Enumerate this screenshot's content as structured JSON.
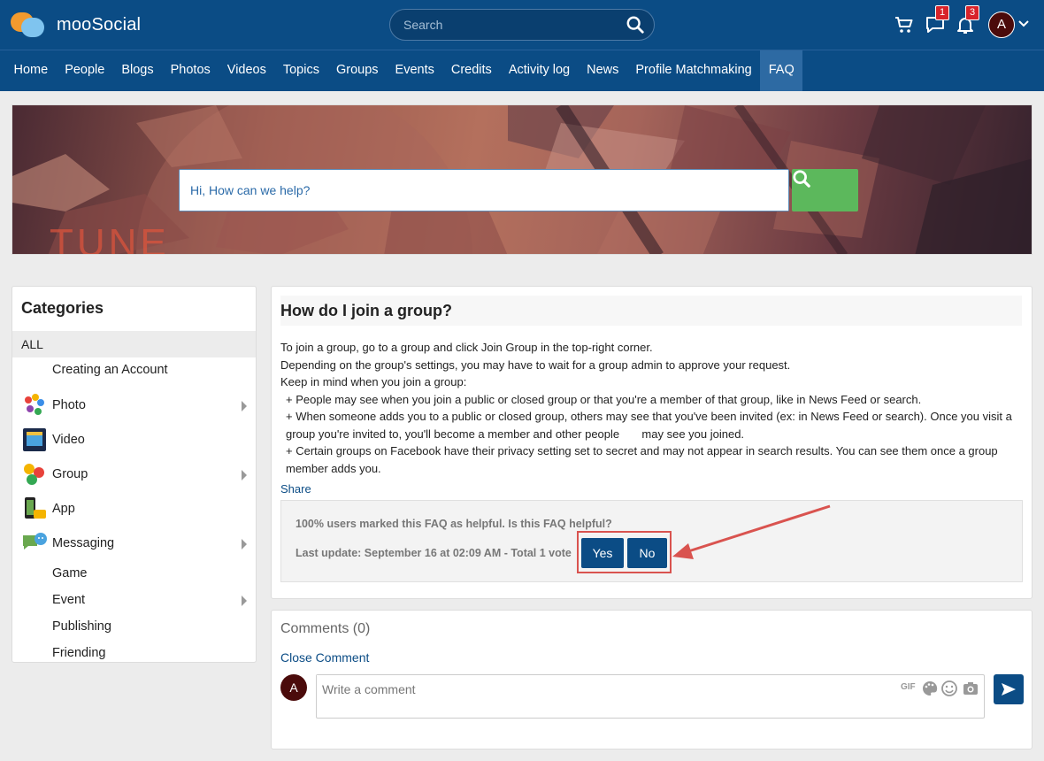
{
  "header": {
    "logo_text": "mooSocial",
    "search_placeholder": "Search",
    "messages_count": "1",
    "notifications_count": "3",
    "avatar_initial": "A"
  },
  "nav": {
    "items": [
      "Home",
      "People",
      "Blogs",
      "Photos",
      "Videos",
      "Topics",
      "Groups",
      "Events",
      "Credits",
      "Activity log",
      "News",
      "Profile Matchmaking",
      "FAQ"
    ],
    "active": "FAQ"
  },
  "banner": {
    "search_placeholder": "Hi, How can we help?"
  },
  "categories": {
    "title": "Categories",
    "all_label": "ALL",
    "items": [
      {
        "label": "Creating an Account",
        "icon": "none",
        "has_children": false
      },
      {
        "label": "Photo",
        "icon": "photo-icon",
        "has_children": true
      },
      {
        "label": "Video",
        "icon": "video-icon",
        "has_children": false
      },
      {
        "label": "Group",
        "icon": "group-icon",
        "has_children": true
      },
      {
        "label": "App",
        "icon": "app-icon",
        "has_children": false
      },
      {
        "label": "Messaging",
        "icon": "messaging-icon",
        "has_children": true
      },
      {
        "label": "Game",
        "icon": "none",
        "has_children": false
      },
      {
        "label": "Event",
        "icon": "none",
        "has_children": true
      },
      {
        "label": "Publishing",
        "icon": "none",
        "has_children": false
      },
      {
        "label": "Friending",
        "icon": "none",
        "has_children": false
      }
    ]
  },
  "faq": {
    "title": "How do I join a group?",
    "body": [
      "To join a group, go to a group and click Join Group in the top-right corner.",
      "Depending on the group's settings, you may have to wait for a group admin to approve your request.",
      "Keep in mind when you join a group:",
      "+ People may see when you join a public or closed group or that you're a member of that group, like in News Feed or search.",
      "+ When someone adds you to a public or closed group, others may see that you've been invited (ex: in News Feed or search). Once you visit a group you're invited to, you'll become a member and other people       may see you joined.",
      "+ Certain groups on Facebook have their privacy setting set to secret and may not appear in search results. You can see them once a group member adds you."
    ],
    "share_label": "Share",
    "helpful_text": "100% users marked this FAQ as helpful. Is this FAQ helpful?",
    "last_update": "Last update: September 16 at 02:09 AM - Total 1 vote",
    "yes_label": "Yes",
    "no_label": "No"
  },
  "comments": {
    "title": "Comments (0)",
    "close_label": "Close Comment",
    "placeholder": "Write a comment",
    "gif_label": "GIF",
    "avatar_initial": "A"
  },
  "colors": {
    "header_bg": "#0b4c85",
    "active_nav": "#2d6aa3",
    "search_button": "#5cb85c",
    "vote_button": "#0b4c85",
    "highlight": "#d9534f",
    "badge": "#d8232a"
  }
}
